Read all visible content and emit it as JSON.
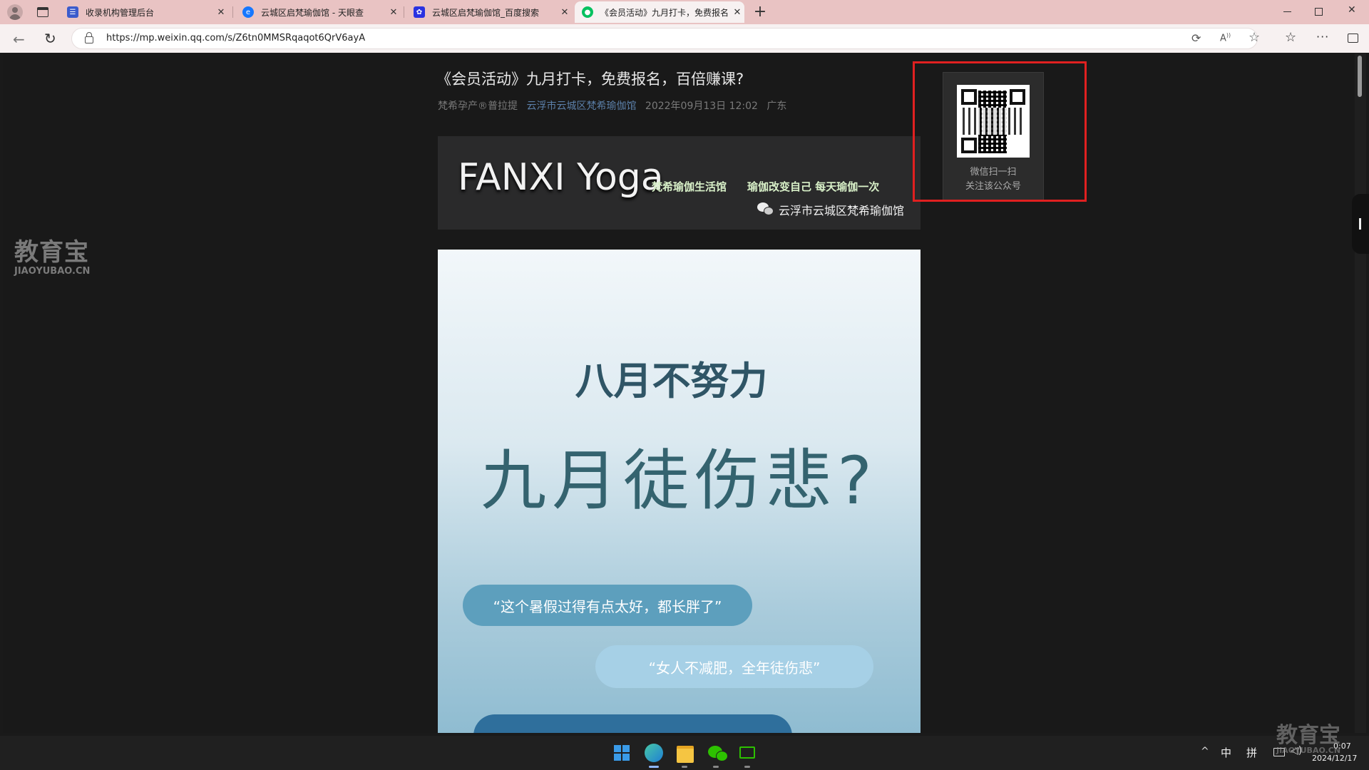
{
  "browser": {
    "tabs": [
      {
        "title": "收录机构管理后台",
        "favicon": "grid-favicon",
        "color": "#3b5bcc"
      },
      {
        "title": "云城区启梵瑜伽馆 - 天眼查",
        "favicon": "tianyancha-favicon",
        "color": "#1677ff"
      },
      {
        "title": "云城区启梵瑜伽馆_百度搜索",
        "favicon": "baidu-paw-favicon",
        "color": "#2932e1"
      },
      {
        "title": "《会员活动》九月打卡，免费报名",
        "favicon": "wechat-favicon",
        "color": "#07c160"
      }
    ],
    "new_tab_label": "+",
    "url": "https://mp.weixin.qq.com/s/Z6tn0MMSRqaqot6QrV6ayA"
  },
  "article": {
    "title": "《会员活动》九月打卡，免费报名，百倍赚课?",
    "author": "梵希孕产®普拉提",
    "account": "云浮市云城区梵希瑜伽馆",
    "date": "2022年09月13日 12:02",
    "location": "广东",
    "banner": {
      "brand": "FANXI Yoga",
      "slogan1": "梵希瑜伽生活馆",
      "slogan2": "瑜伽改变自己 每天瑜伽一次",
      "wechat_name": "云浮市云城区梵希瑜伽馆"
    },
    "poster": {
      "line1": "八月不努力",
      "line2": "九月徒伤悲?",
      "bubble1": "“这个暑假过得有点太好，都长胖了”",
      "bubble2": "“女人不减肥，全年徒伤悲”"
    }
  },
  "qr_panel": {
    "line1": "微信扫一扫",
    "line2": "关注该公众号"
  },
  "watermark": {
    "cn": "教育宝",
    "en": "JIAOYUBAO.CN"
  },
  "taskbar": {
    "ime1": "中",
    "ime2": "拼",
    "time": "0:07",
    "date": "2024/12/17"
  }
}
